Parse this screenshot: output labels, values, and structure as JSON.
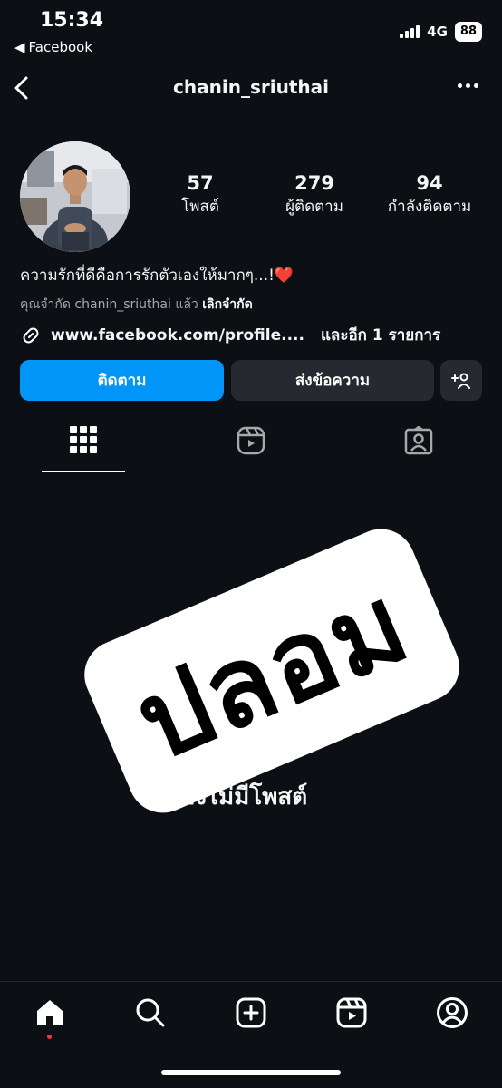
{
  "status_bar": {
    "time": "15:34",
    "back_app": "Facebook",
    "network": "4G",
    "battery": "88"
  },
  "header": {
    "username": "chanin_sriuthai"
  },
  "profile": {
    "stats": [
      {
        "value": "57",
        "label": "โพสต์"
      },
      {
        "value": "279",
        "label": "ผู้ติดตาม"
      },
      {
        "value": "94",
        "label": "กำลังติดตาม"
      }
    ],
    "bio": "ความรักที่ดีคือการรักตัวเองให้มากๆ...!❤️",
    "muted_text": "คุณจำกัด chanin_sriuthai แล้ว",
    "unrestrict": "เลิกจำกัด",
    "link": "www.facebook.com/profile....",
    "link_more": "และอีก 1 รายการ"
  },
  "actions": {
    "follow": "ติดตาม",
    "message": "ส่งข้อความ",
    "suggest_icon": "add-person-icon"
  },
  "tabs": [
    "grid-icon",
    "reels-icon",
    "tagged-icon"
  ],
  "content": {
    "sticker_text": "ปลอม",
    "no_posts": "ยังไม่มีโพสต์"
  },
  "bottom_nav": [
    "home-icon",
    "search-icon",
    "create-icon",
    "reels-icon",
    "profile-icon"
  ],
  "colors": {
    "background": "#0c1014",
    "primary_button": "#0095f6",
    "secondary_button": "#262a30",
    "notification_dot": "#ff3040"
  }
}
